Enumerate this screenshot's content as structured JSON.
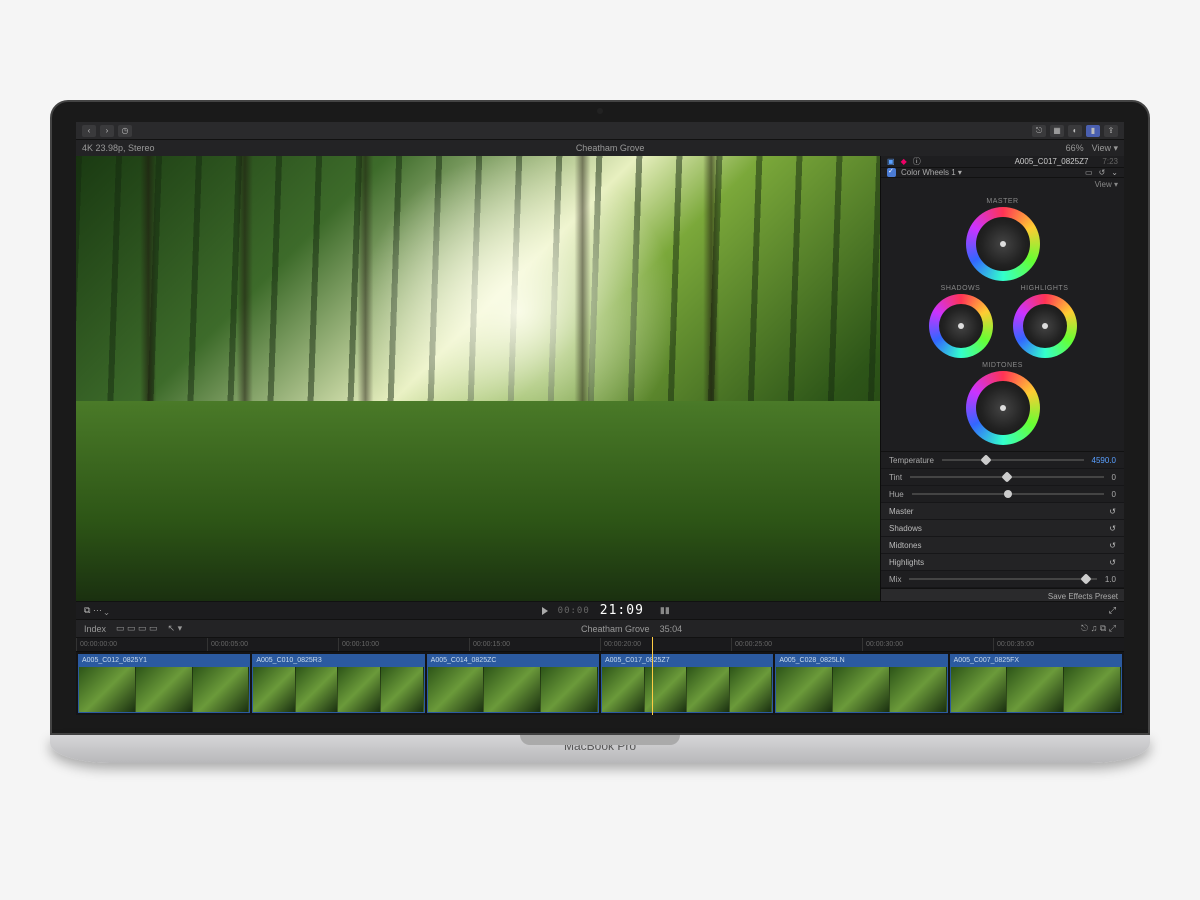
{
  "device_label": "MacBook Pro",
  "topbar": {
    "back_icon": "‹",
    "fwd_icon": "›",
    "clock_icon": "◷",
    "link_icon": "⎋",
    "grid_icon": "▦",
    "toggle_icon": "◐",
    "color_icon": "▮",
    "share_icon": "⇪"
  },
  "viewer_header": {
    "format": "4K 23.98p, Stereo",
    "clip_name": "Cheatham Grove",
    "zoom": "66%",
    "view_label": "View ▾"
  },
  "inspector": {
    "clip_id": "A005_C017_0825Z7",
    "tc_right": "7:23",
    "panel_title": "Color Wheels 1 ▾",
    "view_label": "View ▾",
    "wheels": {
      "master": "MASTER",
      "shadows": "SHADOWS",
      "highlights": "HIGHLIGHTS",
      "midtones": "MIDTONES"
    },
    "params": {
      "temperature_label": "Temperature",
      "temperature_value": "4590.0",
      "tint_label": "Tint",
      "tint_value": "0",
      "hue_label": "Hue",
      "hue_value": "0",
      "sections": [
        "Master",
        "Shadows",
        "Midtones",
        "Highlights"
      ],
      "mix_label": "Mix",
      "mix_value": "1.0"
    },
    "save_preset": "Save Effects Preset"
  },
  "transport": {
    "left_icons": "⧉  ⋯  ⌄",
    "tc_small": "00:00",
    "tc_main": "21:09",
    "expand_icon": "⤢"
  },
  "timeline": {
    "index_label": "Index",
    "project_name": "Cheatham Grove",
    "project_duration": "35:04",
    "ruler": [
      "00:00:00:00",
      "00:00:05:00",
      "00:00:10:00",
      "00:00:15:00",
      "00:00:20:00",
      "00:00:25:00",
      "00:00:30:00",
      "00:00:35:00"
    ],
    "clips": [
      "A005_C012_0825Y1",
      "A005_C010_0825R3",
      "A005_C014_0825ZC",
      "A005_C017_0825Z7",
      "A005_C028_0825LN",
      "A005_C007_0825FX"
    ],
    "right_icons": "⎋  ♫  ⧉  ⤢"
  }
}
